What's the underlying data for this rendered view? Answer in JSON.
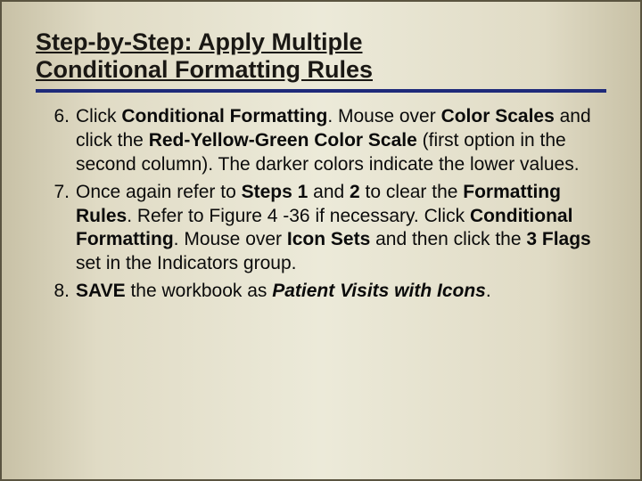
{
  "title_line1": "Step-by-Step: Apply Multiple",
  "title_line2": "Conditional Formatting Rules",
  "steps": [
    {
      "num": "6.",
      "t1": "Click ",
      "b1": "Conditional Formatting",
      "t2": ". Mouse over ",
      "b2": "Color Scales",
      "t3": " and click the ",
      "b3": "Red-Yellow-Green Color Scale",
      "t4": " (first option in the second column). The darker colors indicate the lower values."
    },
    {
      "num": "7.",
      "t1": "Once again refer to ",
      "b1": "Steps 1",
      "t2": " and ",
      "b2": "2",
      "t3": " to clear the ",
      "b3": "Formatting Rules",
      "t4": ". Refer to Figure 4 -36 if necessary. Click ",
      "b4": "Conditional Formatting",
      "t5": ". Mouse over ",
      "b5": "Icon Sets",
      "t6": " and then click the ",
      "b6": "3 Flags",
      "t7": " set in the Indicators group."
    },
    {
      "num": "8.",
      "b1": "SAVE",
      "t2": " the workbook as ",
      "bi1": "Patient Visits with Icons",
      "t3": "."
    }
  ]
}
